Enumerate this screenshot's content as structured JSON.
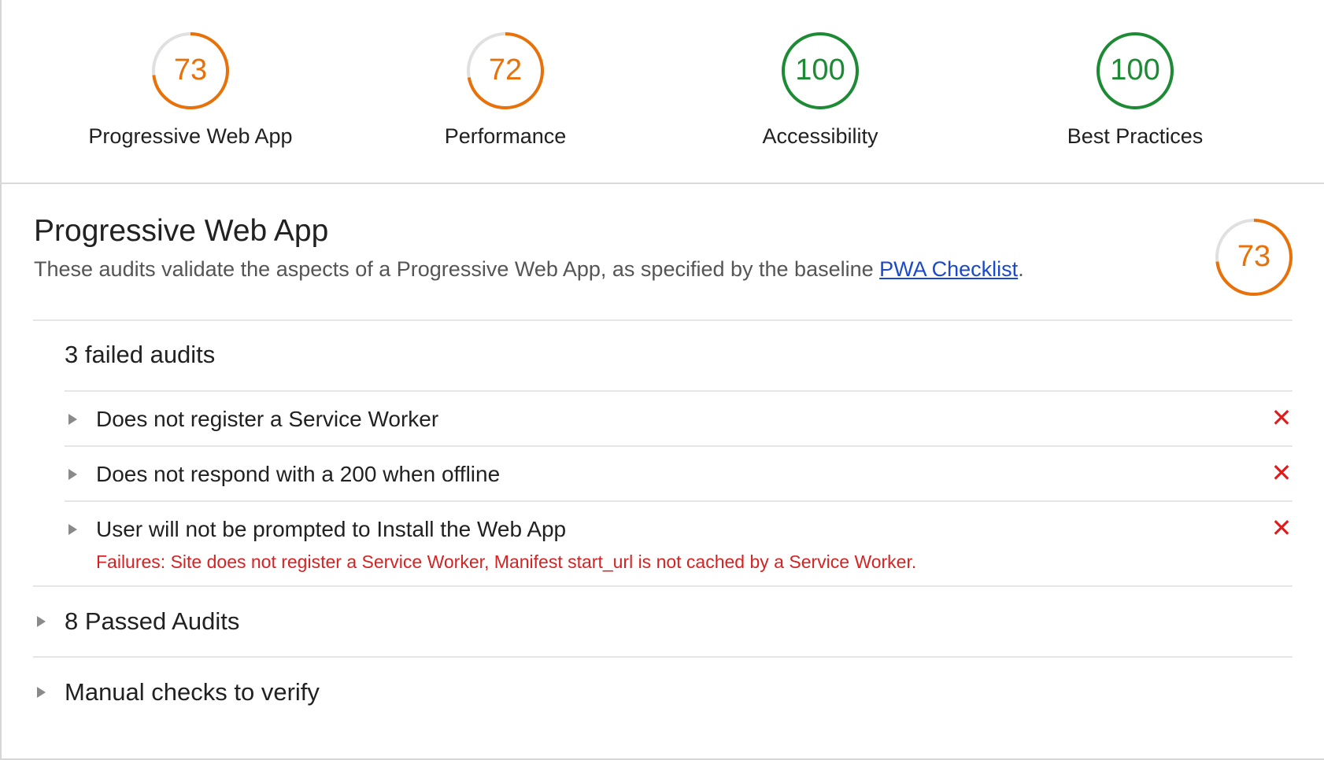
{
  "summary": {
    "gauges": [
      {
        "label": "Progressive Web App",
        "score": "73",
        "value": 73,
        "color": "#e8710a"
      },
      {
        "label": "Performance",
        "score": "72",
        "value": 72,
        "color": "#e8710a"
      },
      {
        "label": "Accessibility",
        "score": "100",
        "value": 100,
        "color": "#1d8a34"
      },
      {
        "label": "Best Practices",
        "score": "100",
        "value": 100,
        "color": "#1d8a34"
      }
    ]
  },
  "category": {
    "title": "Progressive Web App",
    "description_prefix": "These audits validate the aspects of a Progressive Web App, as specified by the baseline ",
    "link_text": "PWA Checklist",
    "description_suffix": ".",
    "score": "73",
    "value": 73,
    "color": "#e8710a"
  },
  "failed_group": {
    "title": "3 failed audits",
    "audits": [
      {
        "label": "Does not register a Service Worker",
        "icon": "close-icon"
      },
      {
        "label": "Does not respond with a 200 when offline",
        "icon": "close-icon"
      },
      {
        "label": "User will not be prompted to Install the Web App",
        "icon": "close-icon",
        "failure": "Failures: Site does not register a Service Worker, Manifest start_url is not cached by a Service Worker."
      }
    ]
  },
  "passed_group": {
    "title": "8 Passed Audits"
  },
  "manual_group": {
    "title": "Manual checks to verify"
  },
  "colors": {
    "average": "#e8710a",
    "pass": "#1d8a34",
    "fail": "#e01b1b",
    "link": "#1a49c9",
    "track": "#e0e0e0"
  }
}
